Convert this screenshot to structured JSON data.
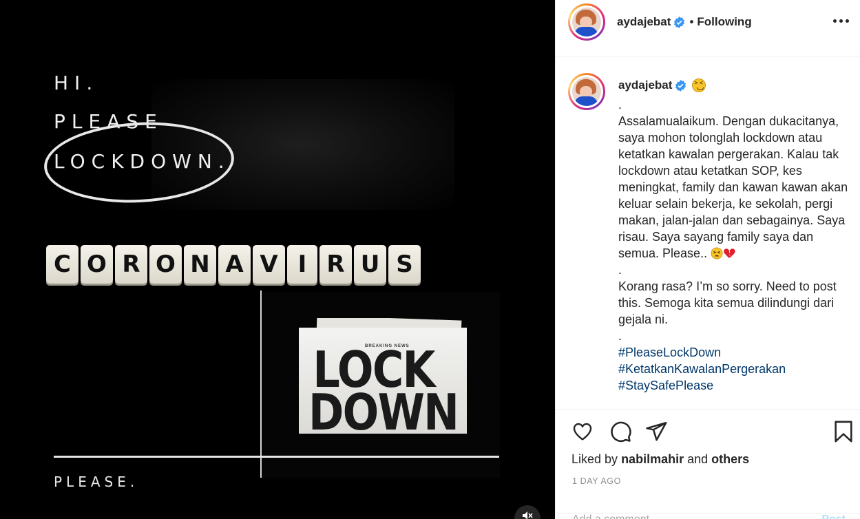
{
  "media": {
    "text_line1": "HI.",
    "text_line2": "PLEASE",
    "text_line3": "LOCKDOWN.",
    "tiles": [
      "C",
      "O",
      "R",
      "O",
      "N",
      "A",
      "V",
      "I",
      "R",
      "U",
      "S"
    ],
    "newspaper_kicker": "BREAKING NEWS",
    "newspaper_headline": "LOCK DOWN",
    "bottom_text": "PLEASE.",
    "mute_icon": "speaker-muted-icon"
  },
  "header": {
    "username": "aydajebat",
    "separator": "•",
    "follow_label": "Following",
    "more_icon": "more-options-icon"
  },
  "caption": {
    "username": "aydajebat",
    "dot1": ".",
    "paragraph1": "Assalamualaikum. Dengan dukacitanya, saya mohon tolonglah lockdown atau ketatkan kawalan pergerakan. Kalau tak lockdown atau ketatkan SOP, kes meningkat, family dan kawan kawan akan keluar selain bekerja, ke sekolah, pergi makan, jalan-jalan dan sebagainya. Saya risau. Saya sayang family saya dan semua. Please..",
    "dot2": ".",
    "paragraph2": "Korang rasa? I’m so sorry. Need to post this. Semoga kita semua dilindungi dari gejala ni.",
    "dot3": ".",
    "hashtags": [
      "#PleaseLockDown",
      "#KetatkanKawalanPergerakan",
      "#StaySafePlease"
    ]
  },
  "actions": {
    "like_icon": "heart-icon",
    "comment_icon": "comment-icon",
    "share_icon": "share-icon",
    "save_icon": "bookmark-icon",
    "liked_prefix": "Liked by",
    "liked_user": "nabilmahir",
    "liked_and": "and",
    "liked_others": "others",
    "timestamp": "1 DAY AGO"
  },
  "comment": {
    "placeholder": "Add a comment…",
    "post_label": "Post"
  },
  "colors": {
    "verified": "#3897f0",
    "hashtag": "#00376b",
    "muted_text": "#8e8e8e"
  }
}
